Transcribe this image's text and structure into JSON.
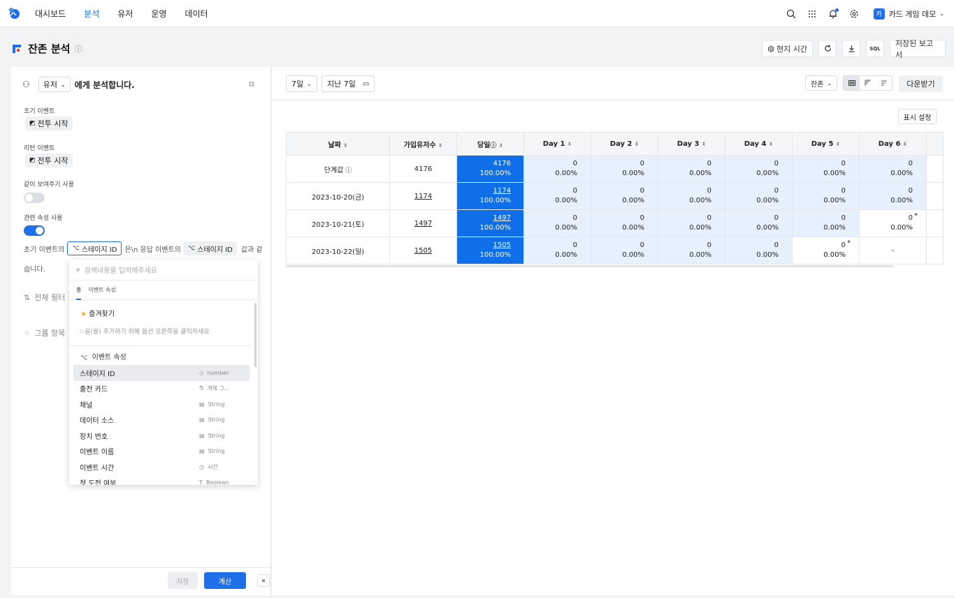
{
  "nav": {
    "items": [
      "대시보드",
      "분석",
      "유저",
      "운영",
      "데이터"
    ],
    "active_index": 1,
    "project_avatar": "카",
    "project_name": "카드 게임 데모"
  },
  "header": {
    "title": "잔존 분석",
    "local_time": "현지 시간",
    "sql": "SQL",
    "saved_reports": "저장된 보고서"
  },
  "left": {
    "subject": "유저",
    "analyze_suffix": "에게 분석합니다.",
    "initial_event_label": "초기 이벤트",
    "initial_event": "전투 시작",
    "return_event_label": "리턴 이벤트",
    "return_event": "전투 시작",
    "show_together_label": "같이 보여주기 사용",
    "related_prop_label": "관련 속성 사용",
    "sentence_pre": "초기 이벤트의",
    "prop_a": "스테이지 ID",
    "sentence_mid": "은\\n 응답 이벤트의",
    "prop_b": "스테이지 ID",
    "sentence_post": "값과 같",
    "sentence_end": "습니다.",
    "global_filter": "전체 필터",
    "group_items": "그룹 항목",
    "save": "저장",
    "calculate": "계산"
  },
  "dropdown": {
    "search_placeholder": "검색내용을 입력해주세요",
    "tab_all": "총",
    "tab_event_props": "이벤트 속성",
    "favorites": "즐겨찾기",
    "fav_hint": "☆을(를) 추가하기 위해 옵션 오른쪽을 클릭하세요",
    "group_title": "이벤트 속성",
    "items": [
      {
        "name": "스테이지 ID",
        "type": "number",
        "icon": "◇"
      },
      {
        "name": "출전 카드",
        "type": "개체 그...",
        "icon": "⅋"
      },
      {
        "name": "채널",
        "type": "String",
        "icon": "▤"
      },
      {
        "name": "데이터 소스",
        "type": "String",
        "icon": "▤"
      },
      {
        "name": "장치 번호",
        "type": "String",
        "icon": "▤"
      },
      {
        "name": "이벤트 이름",
        "type": "String",
        "icon": "▤"
      },
      {
        "name": "이벤트 시간",
        "type": "시간",
        "icon": "◷"
      },
      {
        "name": "첫 도전 여부",
        "type": "Boolean",
        "icon": "T"
      }
    ]
  },
  "right": {
    "period": "7일",
    "date_range": "지난 7일",
    "metric": "잔존",
    "download": "다운받기",
    "display_settings": "표시 설정",
    "columns": [
      "날짜",
      "가입유저수",
      "당일",
      "Day 1",
      "Day 2",
      "Day 3",
      "Day 4",
      "Day 5",
      "Day 6"
    ],
    "rows": [
      {
        "date": "단계값",
        "users": "4176",
        "underline": false,
        "info": true,
        "cells": [
          [
            "4176",
            "100.00%"
          ],
          [
            "0",
            "0.00%"
          ],
          [
            "0",
            "0.00%"
          ],
          [
            "0",
            "0.00%"
          ],
          [
            "0",
            "0.00%"
          ],
          [
            "0",
            "0.00%"
          ],
          [
            "0",
            "0.00%"
          ]
        ],
        "kinds": [
          "blue",
          "light",
          "light",
          "light",
          "light",
          "light",
          "light"
        ]
      },
      {
        "date": "2023-10-20(금)",
        "users": "1174",
        "underline": true,
        "info": false,
        "cells": [
          [
            "1174",
            "100.00%"
          ],
          [
            "0",
            "0.00%"
          ],
          [
            "0",
            "0.00%"
          ],
          [
            "0",
            "0.00%"
          ],
          [
            "0",
            "0.00%"
          ],
          [
            "0",
            "0.00%"
          ],
          [
            "0",
            "0.00%"
          ]
        ],
        "kinds": [
          "blue",
          "light",
          "light",
          "light",
          "light",
          "light",
          "light"
        ]
      },
      {
        "date": "2023-10-21(토)",
        "users": "1497",
        "underline": true,
        "info": false,
        "cells": [
          [
            "1497",
            "100.00%"
          ],
          [
            "0",
            "0.00%"
          ],
          [
            "0",
            "0.00%"
          ],
          [
            "0",
            "0.00%"
          ],
          [
            "0",
            "0.00%"
          ],
          [
            "0",
            "0.00%"
          ],
          [
            "0",
            "0.00%"
          ]
        ],
        "kinds": [
          "blue",
          "light",
          "light",
          "light",
          "light",
          "light",
          "white-star"
        ]
      },
      {
        "date": "2023-10-22(일)",
        "users": "1505",
        "underline": true,
        "info": false,
        "cells": [
          [
            "1505",
            "100.00%"
          ],
          [
            "0",
            "0.00%"
          ],
          [
            "0",
            "0.00%"
          ],
          [
            "0",
            "0.00%"
          ],
          [
            "0",
            "0.00%"
          ],
          [
            "0",
            "0.00%"
          ],
          [
            "-",
            ""
          ]
        ],
        "kinds": [
          "blue",
          "light",
          "light",
          "light",
          "light",
          "white-star",
          "dash"
        ]
      }
    ]
  },
  "colors": {
    "accent": "#1e6fe8",
    "cell_blue": "#0e6fe8",
    "cell_light": "#e6f1fd"
  }
}
